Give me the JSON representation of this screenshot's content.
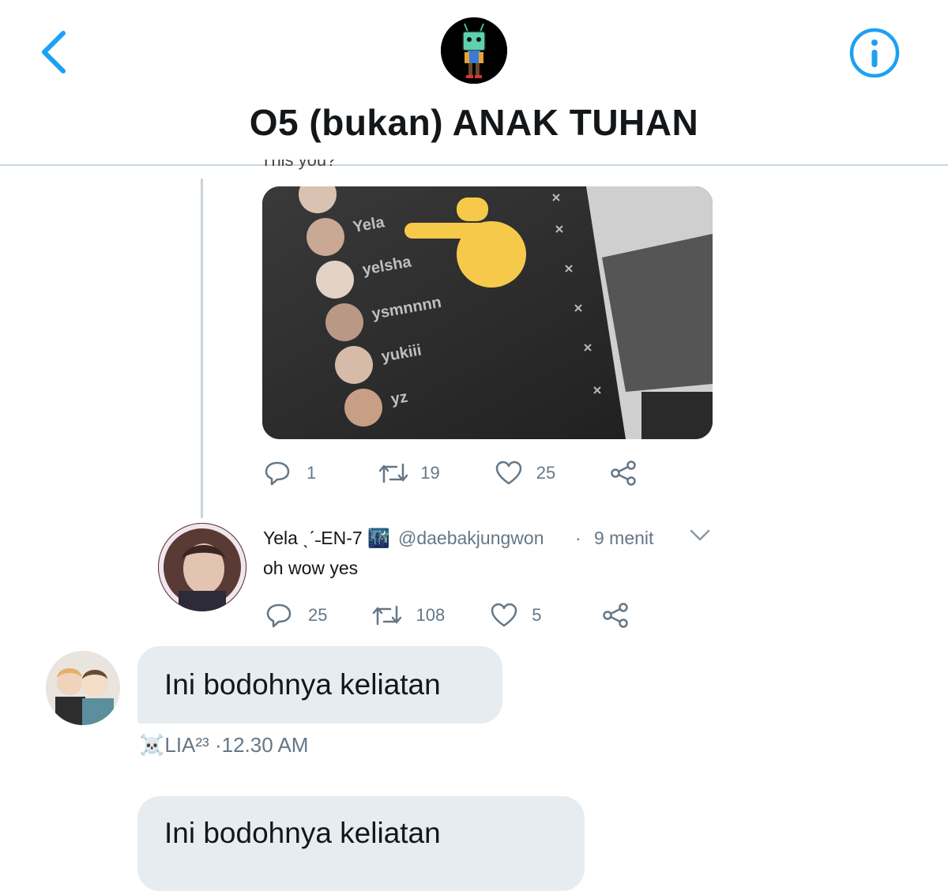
{
  "header": {
    "title": "O5 (bukan) ANAK TUHAN",
    "back_icon": "chevron-left-icon",
    "info_icon": "info-icon",
    "accent": "#1da1f2"
  },
  "shared_tweet": {
    "cut_text": "This you?",
    "media": {
      "usernames": [
        "Yela",
        "yelsha",
        "ysmnnnn",
        "yukiii",
        "yz"
      ],
      "pointer_emoji": "👉"
    },
    "actions": {
      "replies": "1",
      "retweets": "19",
      "likes": "25"
    }
  },
  "reply_tweet": {
    "display_name": "Yela ˎˊ˗EN-7 🌃",
    "handle": "@daebakjungwon",
    "separator": "·",
    "time": "9 menit",
    "text": "oh wow yes",
    "actions": {
      "replies": "25",
      "retweets": "108",
      "likes": "5"
    }
  },
  "messages": [
    {
      "text": "Ini bodohnya keliatan"
    },
    {
      "text": "Ini bodohnya keliatan"
    }
  ],
  "sender": {
    "name": "☠️LIA²³",
    "time": "·12.30 AM"
  }
}
